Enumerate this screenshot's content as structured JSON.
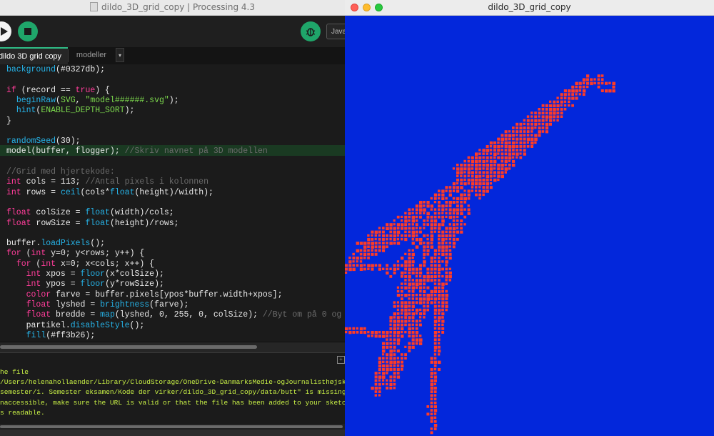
{
  "ide": {
    "window_title": "dildo_3D_grid_copy | Processing 4.3",
    "mode_label": "Java",
    "tabs": [
      {
        "label": "dildo 3D grid copy",
        "active": true
      },
      {
        "label": "modeller",
        "active": false
      }
    ],
    "colors": {
      "keyword": "#ff3d9a",
      "function": "#26b3e8",
      "string": "#7edc4e",
      "comment": "#6c6c6c",
      "console_text": "#c9f146",
      "accent_green": "#1fa66a"
    },
    "code_lines": [
      "background(#0327db);",
      "",
      "if (record == true) {",
      "  beginRaw(SVG, \"model######.svg\");",
      "  hint(ENABLE_DEPTH_SORT);",
      "}",
      "",
      "randomSeed(30);",
      "model(buffer, flogger); //Skriv navnet på 3D modellen",
      "",
      "//Grid med hjertekode:",
      "int cols = 113; //Antal pixels i kolonnen",
      "int rows = ceil(cols*float(height)/width);",
      "",
      "float colSize = float(width)/cols;",
      "float rowSize = float(height)/rows;",
      "",
      "buffer.loadPixels();",
      "for (int y=0; y<rows; y++) {",
      "  for (int x=0; x<cols; x++) {",
      "    int xpos = floor(x*colSize);",
      "    int ypos = floor(y*rowSize);",
      "    color farve = buffer.pixels[ypos*buffer.width+xpos];",
      "    float lyshed = brightness(farve);",
      "    float bredde = map(lyshed, 0, 255, 0, colSize); //Byt om på 0 og",
      "    partikel.disableStyle();",
      "    fill(#ff3b26);"
    ],
    "console_lines": [
      "he file",
      "/Users/helenahollaender/Library/CloudStorage/OneDrive-DanmarksMedie-ogJournalisthøjskol",
      "semester/1. Semester eksamen/Kode der virker/dildo_3D_grid_copy/data/butt\" is missing o",
      "naccessible, make sure the URL is valid or that the file has been added to your sketch",
      "s readable."
    ]
  },
  "sketch": {
    "window_title": "dildo_3D_grid_copy",
    "background_color": "#0327db",
    "particle_color": "#ff3b26"
  }
}
